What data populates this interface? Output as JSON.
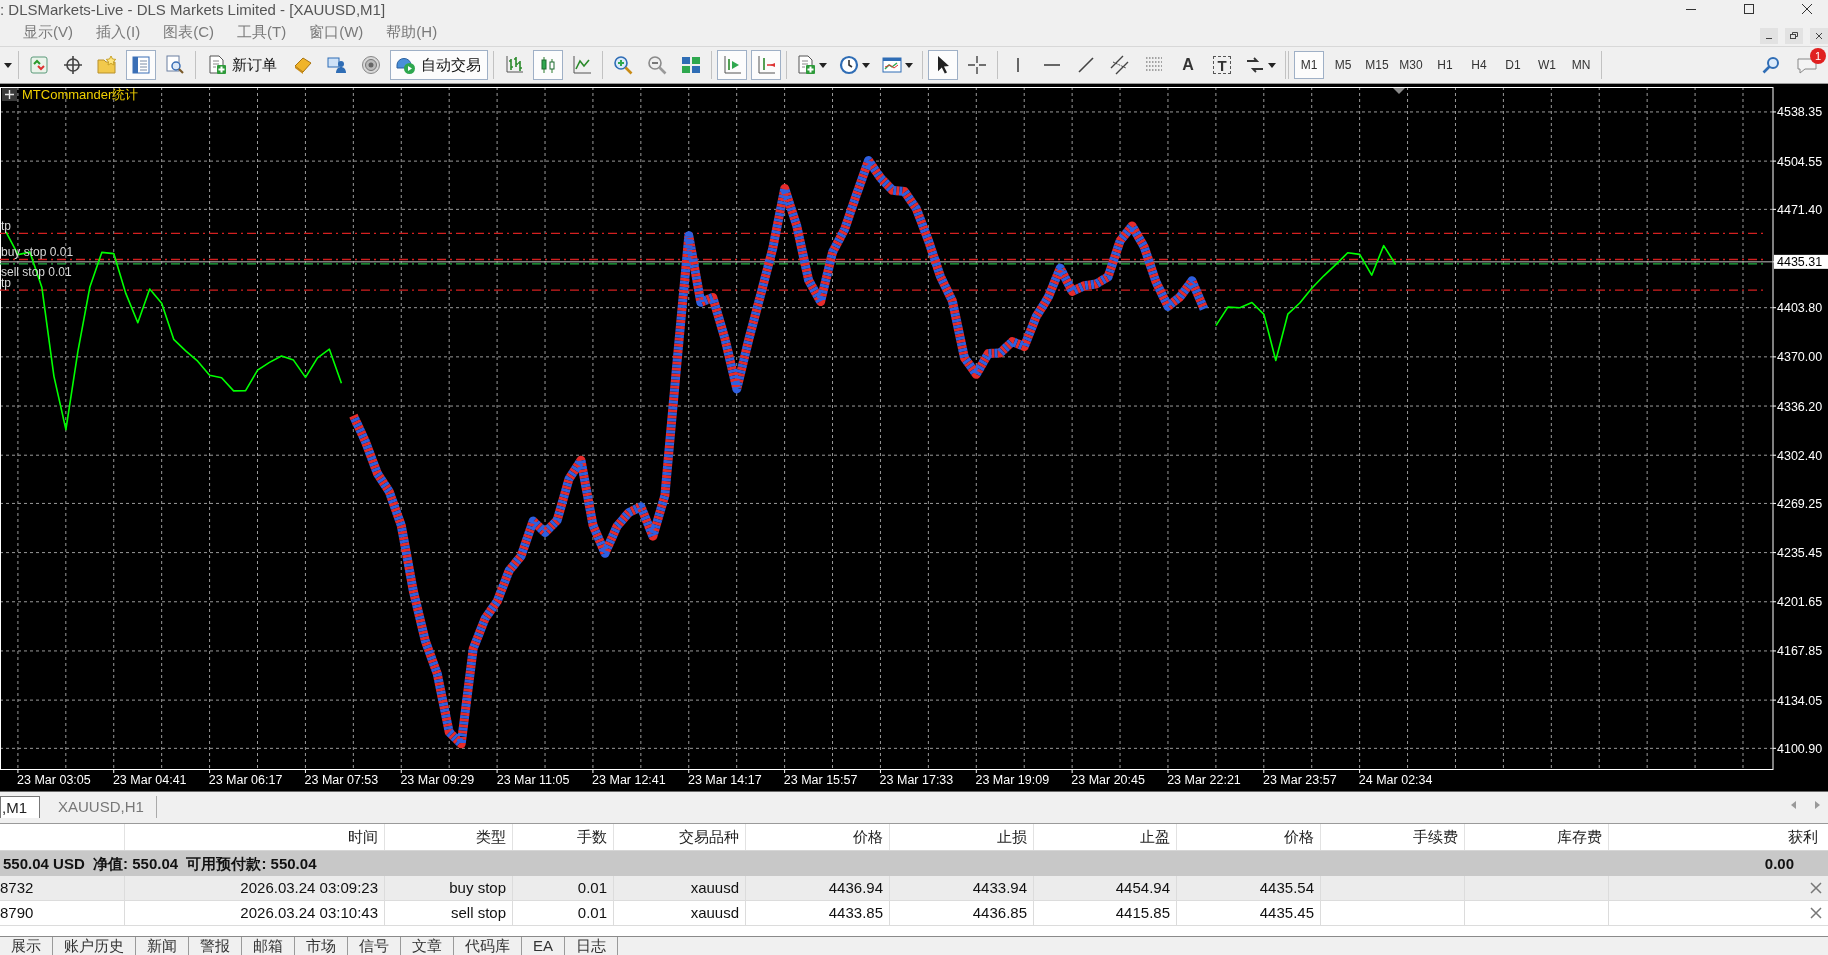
{
  "window": {
    "title": ": DLSMarkets-Live - DLS Markets Limited - [XAUUSD,M1]"
  },
  "menu": [
    "显示(V)",
    "插入(I)",
    "图表(C)",
    "工具(T)",
    "窗口(W)",
    "帮助(H)"
  ],
  "toolbar": {
    "groups": [
      {
        "items": [
          {
            "kind": "caret"
          }
        ]
      },
      {
        "items": [
          {
            "kind": "icon",
            "pressed": false
          },
          {
            "kind": "icon",
            "pressed": false
          },
          {
            "kind": "icon",
            "pressed": false
          },
          {
            "kind": "icon",
            "pressed": true
          },
          {
            "kind": "icon",
            "pressed": false
          }
        ]
      },
      {
        "items": [
          {
            "kind": "text",
            "label": "新订单",
            "pressed": false
          },
          {
            "kind": "icon",
            "pressed": false
          },
          {
            "kind": "icon",
            "pressed": false
          },
          {
            "kind": "icon",
            "pressed": false
          },
          {
            "kind": "text",
            "label": "自动交易",
            "pressed": true
          }
        ]
      },
      {
        "items": [
          {
            "kind": "icon",
            "pressed": false
          },
          {
            "kind": "icon",
            "pressed": true
          },
          {
            "kind": "icon",
            "pressed": false
          }
        ]
      },
      {
        "items": [
          {
            "kind": "icon",
            "pressed": false
          },
          {
            "kind": "icon",
            "pressed": false
          },
          {
            "kind": "icon",
            "pressed": false
          }
        ]
      },
      {
        "items": [
          {
            "kind": "icon",
            "pressed": true
          },
          {
            "kind": "icon",
            "pressed": true
          }
        ]
      },
      {
        "items": [
          {
            "kind": "icon",
            "pressed": false,
            "dropdown": true
          },
          {
            "kind": "icon",
            "pressed": false,
            "dropdown": true
          },
          {
            "kind": "icon",
            "pressed": false,
            "dropdown": true
          }
        ]
      },
      {
        "items": [
          {
            "kind": "icon",
            "pressed": true
          },
          {
            "kind": "icon",
            "pressed": false
          }
        ]
      },
      {
        "items": [
          {
            "kind": "icon",
            "pressed": false
          },
          {
            "kind": "icon",
            "pressed": false
          },
          {
            "kind": "icon",
            "pressed": false
          },
          {
            "kind": "icon",
            "pressed": false
          },
          {
            "kind": "icon",
            "pressed": false
          },
          {
            "kind": "glyph",
            "label": "A",
            "pressed": false
          },
          {
            "kind": "boxed_glyph",
            "label": "T",
            "pressed": false
          },
          {
            "kind": "icon",
            "pressed": false,
            "dropdown": true
          }
        ]
      }
    ],
    "timeframes": [
      {
        "label": "M1",
        "selected": true
      },
      {
        "label": "M5",
        "selected": false
      },
      {
        "label": "M15",
        "selected": false
      },
      {
        "label": "M30",
        "selected": false
      },
      {
        "label": "H1",
        "selected": false
      },
      {
        "label": "H4",
        "selected": false
      },
      {
        "label": "D1",
        "selected": false
      },
      {
        "label": "W1",
        "selected": false
      },
      {
        "label": "MN",
        "selected": false
      }
    ],
    "notifications": {
      "count": "1"
    }
  },
  "chart": {
    "indicator_label": "MTCommander统计",
    "chart_data": {
      "type": "line",
      "grid": true,
      "categories": [
        null,
        null,
        null,
        null,
        "23 Mar 03:05",
        null,
        null,
        null,
        null,
        null,
        null,
        null,
        "23 Mar 04:41",
        null,
        null,
        null,
        null,
        null,
        null,
        null,
        "23 Mar 06:17",
        null,
        null,
        null,
        null,
        null,
        null,
        null,
        "23 Mar 07:53",
        null,
        null,
        null,
        null,
        null,
        null,
        null,
        "23 Mar 09:29",
        null,
        null,
        null,
        null,
        null,
        null,
        null,
        "23 Mar 11:05",
        null,
        null,
        null,
        null,
        null,
        null,
        null,
        "23 Mar 12:41",
        null,
        null,
        null,
        null,
        null,
        null,
        null,
        "23 Mar 14:17",
        null,
        null,
        null,
        null,
        null,
        null,
        null,
        "23 Mar 15:57",
        null,
        null,
        null,
        null,
        null,
        null,
        null,
        "23 Mar 17:33",
        null,
        null,
        null,
        null,
        null,
        null,
        null,
        "23 Mar 19:09",
        null,
        null,
        null,
        null,
        null,
        null,
        null,
        "23 Mar 20:45",
        null,
        null,
        null,
        null,
        null,
        null,
        null,
        "23 Mar 22:21",
        null,
        null,
        null,
        null,
        null,
        null,
        null,
        "23 Mar 23:57",
        null,
        null,
        null,
        null,
        null,
        null,
        null,
        "24 Mar 02:34",
        null,
        null,
        null,
        null,
        null,
        null,
        null,
        null,
        null,
        null,
        null,
        null,
        null,
        null,
        null,
        null,
        null,
        null,
        null,
        null,
        null,
        null,
        null,
        null,
        null,
        null,
        null,
        null,
        null,
        null,
        null
      ],
      "series": [
        {
          "color": "#00ff00",
          "values": [
            4456.0,
            4440.3,
            4442.0,
            4417.6,
            4356.8,
            4320.0,
            4373.8,
            4417.8,
            4441.8,
            4441.0,
            4413.6,
            4393.5,
            4416.6,
            4406.8,
            4382.1,
            4374.1,
            4367.0,
            4357.4,
            4355.7,
            4346.6,
            4346.8,
            4360.9,
            4366.2,
            4370.6,
            4367.8,
            4355.9,
            4369.3,
            4375.3,
            4351.8,
            null,
            null,
            null,
            null,
            null,
            null,
            null,
            null,
            null,
            null,
            null,
            null,
            null,
            null,
            null,
            null,
            null,
            null,
            null,
            null,
            null,
            null,
            null,
            null,
            null,
            null,
            null,
            null,
            null,
            null,
            null,
            null,
            null,
            null,
            null,
            null,
            null,
            null,
            null,
            null,
            null,
            null,
            null,
            null,
            null,
            null,
            null,
            null,
            null,
            null,
            null,
            null,
            null,
            null,
            null,
            null,
            null,
            null,
            null,
            null,
            null,
            null,
            null,
            null,
            null,
            null,
            null,
            null,
            null,
            null,
            null,
            null,
            4391.5,
            4404.2,
            4403.7,
            4407.4,
            4399.2,
            4367.5,
            4399.3,
            4407.0,
            4417.2,
            4425.7,
            4433.4,
            4441.5,
            4440.4,
            4426.1,
            4446.5,
            4433.5,
            null,
            null,
            null,
            null,
            null,
            null,
            null,
            null,
            null,
            null,
            null,
            null,
            null,
            null,
            null,
            null,
            null,
            null,
            null,
            null,
            null,
            null,
            null,
            null,
            null,
            null,
            null,
            null,
            null,
            null,
            null
          ]
        },
        {
          "color": "#e52b2b",
          "line_style": "dashed",
          "values": [
            null,
            null,
            null,
            null,
            null,
            null,
            null,
            null,
            null,
            null,
            null,
            null,
            null,
            null,
            null,
            null,
            null,
            null,
            null,
            null,
            null,
            null,
            null,
            null,
            null,
            null,
            null,
            null,
            null,
            4329.6,
            4311.8,
            4289.8,
            4277.3,
            4254.0,
            4209.1,
            4174.8,
            4152.1,
            4112.0,
            4104.0,
            4169.4,
            4190.3,
            4202.0,
            4223.0,
            4233.1,
            4257.1,
            4249.3,
            4257.6,
            4286.1,
            4299.0,
            4254.2,
            4235.0,
            4253.5,
            4263.0,
            4267.0,
            4246.7,
            4274.8,
            4365.6,
            4453.3,
            4407.5,
            4410.9,
            4382.9,
            4348.0,
            4381.7,
            4412.8,
            4444.5,
            4485.7,
            4460.2,
            4422.7,
            4408.0,
            4442.0,
            4457.7,
            4481.8,
            4505.0,
            4493.1,
            4484.5,
            4483.7,
            4471.8,
            4450.0,
            4425.3,
            4408.4,
            4369.5,
            4358.0,
            4372.3,
            4372.7,
            4380.5,
            4377.1,
            4397.7,
            4410.9,
            4431.0,
            4415.1,
            4418.9,
            4420.1,
            4425.0,
            4449.8,
            4460.0,
            4445.7,
            4421.5,
            4404.7,
            4411.2,
            4422.3,
            4403.0,
            null,
            null,
            null,
            null,
            null,
            null,
            null,
            null,
            null,
            null,
            null,
            null,
            null,
            null,
            null,
            null,
            null,
            null,
            null,
            null,
            null,
            null,
            null,
            null,
            null,
            null,
            null,
            null,
            null,
            null,
            null,
            null,
            null,
            null,
            null,
            null,
            null,
            null,
            null,
            null,
            null,
            null,
            null,
            null,
            null,
            null,
            null
          ]
        }
      ],
      "ylim": [
        4086.7,
        4555.5
      ],
      "yticks": [
        {
          "value": 4538.35,
          "label": "4538.35"
        },
        {
          "value": 4504.55,
          "label": "4504.55"
        },
        {
          "value": 4471.4,
          "label": "4471.40"
        },
        {
          "value": 4435.31,
          "label": "4435.31"
        },
        {
          "value": 4403.8,
          "label": "4403.80"
        },
        {
          "value": 4370.0,
          "label": "4370.00"
        },
        {
          "value": 4336.2,
          "label": "4336.20"
        },
        {
          "value": 4302.4,
          "label": "4302.40"
        },
        {
          "value": 4269.25,
          "label": "4269.25"
        },
        {
          "value": 4235.45,
          "label": "4235.45"
        },
        {
          "value": 4201.65,
          "label": "4201.65"
        },
        {
          "value": 4167.85,
          "label": "4167.85"
        },
        {
          "value": 4134.05,
          "label": "4134.05"
        },
        {
          "value": 4100.9,
          "label": "4100.90"
        }
      ],
      "ref_lines": [
        {
          "axis": "y",
          "value": 4454.94,
          "label": "tp",
          "color": "#d42020"
        },
        {
          "axis": "y",
          "value": 4436.94,
          "label": "buy stop 0.01",
          "color": "#d42020"
        },
        {
          "axis": "y",
          "value": 4435.31,
          "color": "#c0c0c0"
        },
        {
          "axis": "y",
          "value": 4433.85,
          "label": "sell stop 0.01",
          "color": "#20b040"
        },
        {
          "axis": "y",
          "value": 4415.85,
          "label": "tp",
          "color": "#d42020"
        }
      ]
    }
  },
  "chart_tabs": [
    {
      "label": ",M1",
      "selected": true
    },
    {
      "label": "XAUUSD,H1",
      "selected": false
    }
  ],
  "terminal": {
    "columns": [
      "时间",
      "类型",
      "手数",
      "交易品种",
      "价格",
      "止损",
      "止盈",
      "价格",
      "手续费",
      "库存费",
      "获利"
    ],
    "summary": {
      "text": "550.04 USD  净值: 550.04  可用预付款: 550.04",
      "profit": "0.00"
    },
    "rows": [
      {
        "ticket": "8732",
        "time": "2026.03.24 03:09:23",
        "type": "buy stop",
        "lots": "0.01",
        "symbol": "xauusd",
        "price": "4436.94",
        "stop_loss": "4433.94",
        "take_profit": "4454.94",
        "market_price": "4435.54"
      },
      {
        "ticket": "8790",
        "time": "2026.03.24 03:10:43",
        "type": "sell stop",
        "lots": "0.01",
        "symbol": "xauusd",
        "price": "4433.85",
        "stop_loss": "4436.85",
        "take_profit": "4415.85",
        "market_price": "4435.45"
      }
    ],
    "tabs": [
      {
        "label": "展示",
        "selected": false
      },
      {
        "label": "账户历史",
        "selected": false
      },
      {
        "label": "新闻",
        "selected": false
      },
      {
        "label": "警报",
        "selected": false
      },
      {
        "label": "邮箱",
        "selected": false
      },
      {
        "label": "市场",
        "selected": false
      },
      {
        "label": "信号",
        "selected": false
      },
      {
        "label": "文章",
        "selected": false
      },
      {
        "label": "代码库",
        "selected": false
      },
      {
        "label": "EA",
        "selected": false
      },
      {
        "label": "日志",
        "selected": false
      }
    ]
  }
}
